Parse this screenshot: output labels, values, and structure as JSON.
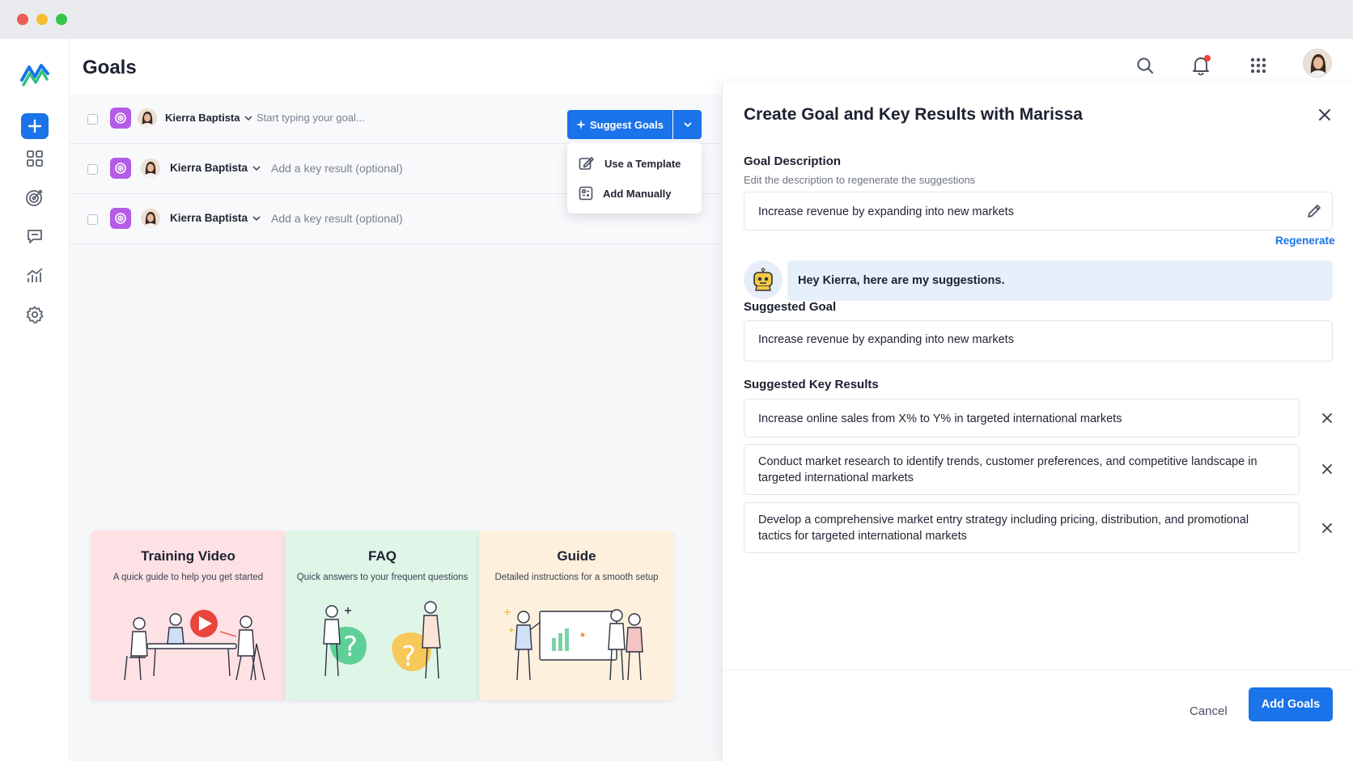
{
  "window": {
    "controls": [
      "close",
      "minimize",
      "maximize"
    ]
  },
  "sidebar": {
    "logo": "wave-logo",
    "items": [
      {
        "icon": "plus-icon",
        "active": true
      },
      {
        "icon": "grid-icon"
      },
      {
        "icon": "target-icon"
      },
      {
        "icon": "chat-icon"
      },
      {
        "icon": "chart-icon"
      },
      {
        "icon": "gear-icon"
      }
    ]
  },
  "header": {
    "title": "Goals",
    "icons": [
      "search-icon",
      "bell-icon",
      "apps-grid-icon",
      "user-avatar"
    ]
  },
  "goal_rows": [
    {
      "owner": "Kierra Baptista",
      "placeholder": "Start typing your goal..."
    },
    {
      "owner": "Kierra Baptista",
      "placeholder": "Add a key result (optional)"
    },
    {
      "owner": "Kierra Baptista",
      "placeholder": "Add a key result (optional)"
    }
  ],
  "suggest": {
    "button_label": "Suggest Goals",
    "menu": [
      {
        "label": "Use a Template",
        "icon": "template-icon"
      },
      {
        "label": "Add Manually",
        "icon": "manual-icon"
      }
    ]
  },
  "cards": [
    {
      "title": "Training Video",
      "subtitle": "A quick guide to help you get started",
      "bg": "#fde1e4"
    },
    {
      "title": "FAQ",
      "subtitle": "Quick answers to your frequent questions",
      "bg": "#dff5e8"
    },
    {
      "title": "Guide",
      "subtitle": "Detailed instructions for a smooth setup",
      "bg": "#fdf0dd"
    }
  ],
  "panel": {
    "title": "Create Goal and Key Results with Marissa",
    "goal_description": {
      "label": "Goal Description",
      "help": "Edit the description to regenerate the suggestions",
      "value": "Increase revenue by expanding into new markets"
    },
    "regenerate": "Regenerate",
    "bot_message": "Hey Kierra, here are my suggestions.",
    "suggested_goal": {
      "label": "Suggested Goal",
      "value": "Increase revenue by expanding into new markets"
    },
    "key_results": {
      "label": "Suggested Key Results",
      "items": [
        "Increase online sales from X% to Y% in targeted international markets",
        "Conduct market research to identify trends, customer preferences, and competitive landscape in targeted international markets",
        "Develop a comprehensive market entry strategy including pricing, distribution, and promotional tactics for targeted international markets"
      ]
    },
    "cancel": "Cancel",
    "add_goals": "Add Goals"
  },
  "colors": {
    "accent": "#1a73e8",
    "goal_icon": "#b45be8",
    "bubble": "#e6f0fb"
  }
}
